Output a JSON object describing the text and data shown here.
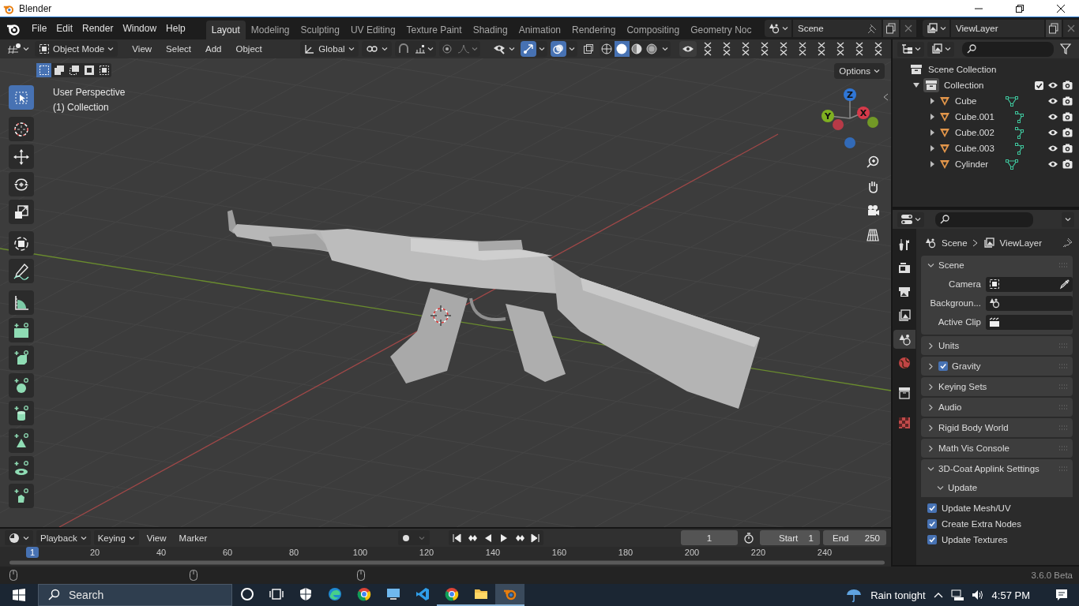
{
  "window": {
    "title": "Blender"
  },
  "menu": [
    "File",
    "Edit",
    "Render",
    "Window",
    "Help"
  ],
  "workspaces": [
    {
      "label": "Layout",
      "selected": true
    },
    {
      "label": "Modeling",
      "selected": false
    },
    {
      "label": "Sculpting",
      "selected": false
    },
    {
      "label": "UV Editing",
      "selected": false
    },
    {
      "label": "Texture Paint",
      "selected": false
    },
    {
      "label": "Shading",
      "selected": false
    },
    {
      "label": "Animation",
      "selected": false
    },
    {
      "label": "Rendering",
      "selected": false
    },
    {
      "label": "Compositing",
      "selected": false
    },
    {
      "label": "Geometry Noc",
      "selected": false
    }
  ],
  "scene": "Scene",
  "view_layer": "ViewLayer",
  "viewport": {
    "mode": "Object Mode",
    "menus": [
      "View",
      "Select",
      "Add",
      "Object"
    ],
    "orientation": "Global",
    "options": "Options",
    "select_modes": [
      {
        "selected": true
      },
      {
        "selected": false
      },
      {
        "selected": false
      },
      {
        "selected": false
      },
      {
        "selected": false
      }
    ],
    "shading_modes": [
      {
        "selected": false
      },
      {
        "selected": true
      },
      {
        "selected": false
      },
      {
        "selected": false
      }
    ],
    "info": [
      "User Perspective",
      "(1) Collection"
    ],
    "axes": [
      {
        "label": "Z",
        "color": "#2f76d6"
      },
      {
        "label": "X",
        "color": "#d63a4a"
      },
      {
        "label": "Y",
        "color": "#7fb021"
      }
    ]
  },
  "tools": [
    {
      "selected": true
    },
    {
      "selected": false
    },
    {
      "selected": false
    },
    {
      "selected": false
    },
    {
      "selected": false
    },
    {
      "selected": false
    },
    {
      "selected": false
    },
    {
      "selected": false
    },
    {
      "selected": false
    },
    {
      "selected": false
    },
    {
      "selected": false
    },
    {
      "selected": false
    },
    {
      "selected": false
    },
    {
      "selected": false
    },
    {
      "selected": false
    }
  ],
  "outliner": {
    "root": "Scene Collection",
    "collections": [
      {
        "label": "Collection",
        "expanded": true,
        "checked": true,
        "children": [
          {
            "label": "Cube",
            "kind": "mesh",
            "expanded": false
          },
          {
            "label": "Cube.001",
            "kind": "curve",
            "expanded": false
          },
          {
            "label": "Cube.002",
            "kind": "curve",
            "expanded": false
          },
          {
            "label": "Cube.003",
            "kind": "curve",
            "expanded": false
          },
          {
            "label": "Cylinder",
            "kind": "mesh",
            "expanded": false
          }
        ]
      }
    ]
  },
  "properties": {
    "breadcrumb": [
      "Scene",
      "ViewLayer"
    ],
    "tabs": [
      {
        "selected": false
      },
      {
        "selected": false
      },
      {
        "selected": false
      },
      {
        "selected": false
      },
      {
        "selected": true
      },
      {
        "selected": false
      },
      {
        "selected": false
      },
      {
        "selected": false
      }
    ],
    "panels": [
      {
        "label": "Scene",
        "expanded": true,
        "fields": [
          "Camera",
          "Backgroun...",
          "Active Clip"
        ]
      },
      {
        "label": "Units",
        "expanded": false
      },
      {
        "label": "Gravity",
        "expanded": false,
        "checked": true
      },
      {
        "label": "Keying Sets",
        "expanded": false
      },
      {
        "label": "Audio",
        "expanded": false
      },
      {
        "label": "Rigid Body World",
        "expanded": false
      },
      {
        "label": "Math Vis Console",
        "expanded": false
      },
      {
        "label": "3D-Coat Applink Settings",
        "expanded": true,
        "subpanels": [
          {
            "label": "Update",
            "expanded": true,
            "options": [
              {
                "label": "Update Mesh/UV",
                "checked": true
              },
              {
                "label": "Create Extra Nodes",
                "checked": true
              },
              {
                "label": "Update Textures",
                "checked": true
              }
            ]
          }
        ]
      }
    ]
  },
  "timeline": {
    "menus": [
      {
        "label": "Playback",
        "dropdown": true
      },
      {
        "label": "Keying",
        "dropdown": true
      },
      {
        "label": "View",
        "dropdown": false
      },
      {
        "label": "Marker",
        "dropdown": false
      }
    ],
    "current_frame": "1",
    "start": {
      "label": "Start",
      "value": "1"
    },
    "end": {
      "label": "End",
      "value": "250"
    },
    "ticks": [
      "20",
      "40",
      "60",
      "80",
      "100",
      "120",
      "140",
      "160",
      "180",
      "200",
      "220",
      "240"
    ],
    "playhead": "1"
  },
  "status_bar": {
    "version": "3.6.0 Beta"
  },
  "taskbar": {
    "search": {
      "placeholder": "Search"
    },
    "apps": [
      {
        "selected": false,
        "running": false
      },
      {
        "selected": false,
        "running": false
      },
      {
        "selected": false,
        "running": false
      },
      {
        "selected": false,
        "running": false
      },
      {
        "selected": false,
        "running": false
      },
      {
        "selected": false,
        "running": false
      },
      {
        "selected": false,
        "running": false
      },
      {
        "selected": false,
        "running": true
      },
      {
        "selected": false,
        "running": true
      },
      {
        "selected": true,
        "running": true
      }
    ],
    "weather": "Rain tonight",
    "time": "4:57 PM"
  }
}
